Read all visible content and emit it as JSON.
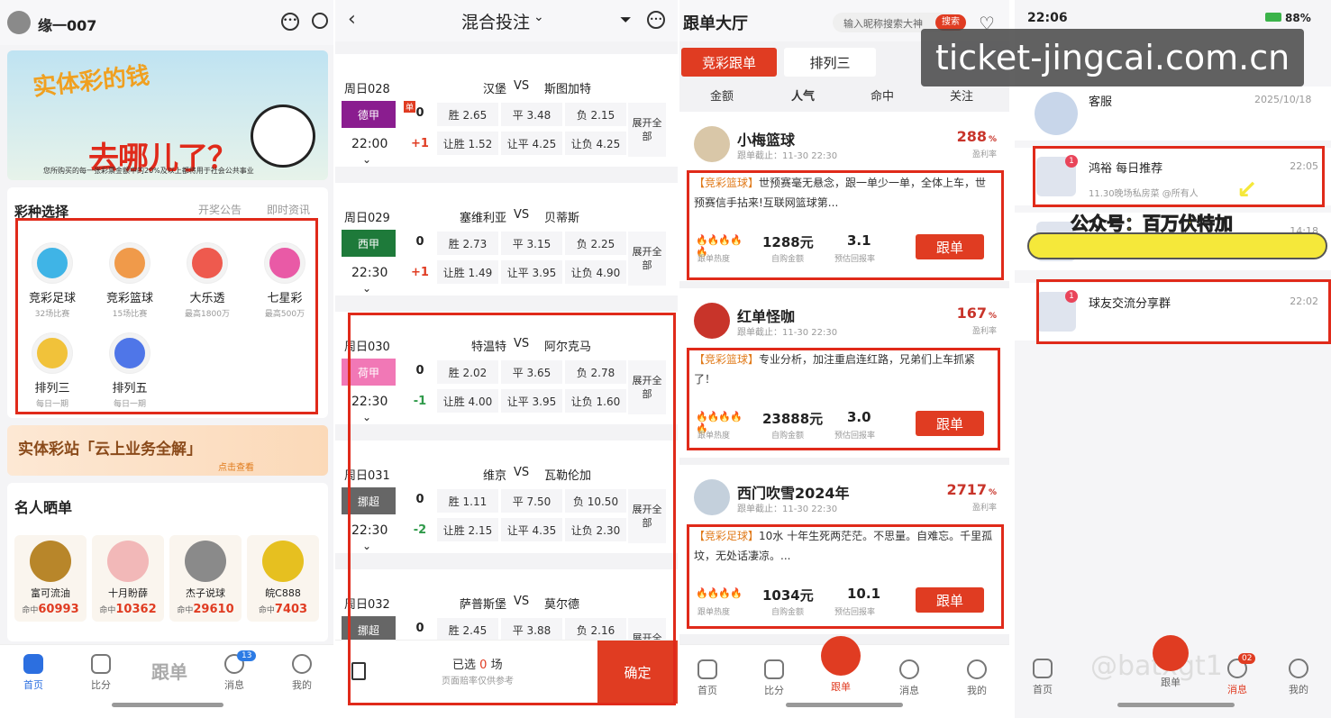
{
  "p1": {
    "username": "缘一007",
    "banner": {
      "title_line1": "实体彩的钱",
      "title_line2": "去哪儿了？",
      "caption": "您所购买的每一张彩票金额中的20%及以上都将用于社会公共事业"
    },
    "section_title": "彩种选择",
    "links": [
      "开奖公告",
      "即时资讯"
    ],
    "lotteries": [
      {
        "name": "竞彩足球",
        "sub": "32场比赛",
        "color": "#3fb4e6"
      },
      {
        "name": "竞彩篮球",
        "sub": "15场比赛",
        "color": "#f09a4a"
      },
      {
        "name": "大乐透",
        "sub": "最高1800万",
        "color": "#ee5a4e"
      },
      {
        "name": "七星彩",
        "sub": "最高500万",
        "color": "#e95aa6"
      },
      {
        "name": "排列三",
        "sub": "每日一期",
        "color": "#f1c23a"
      },
      {
        "name": "排列五",
        "sub": "每日一期",
        "color": "#4f76e8"
      }
    ],
    "promo": {
      "title": "实体彩站「云上业务全解」",
      "cta": "点击查看"
    },
    "famous_title": "名人晒单",
    "famous": [
      {
        "name": "富可流油",
        "hit_label": "命中",
        "hit": "60993"
      },
      {
        "name": "十月盼薛",
        "hit_label": "命中",
        "hit": "10362"
      },
      {
        "name": "杰子说球",
        "hit_label": "命中",
        "hit": "29610"
      },
      {
        "name": "皖C888",
        "hit_label": "命中",
        "hit": "7403"
      }
    ],
    "tabs": [
      "首页",
      "比分",
      "跟单",
      "消息",
      "我的"
    ],
    "msg_badge": "13"
  },
  "p2": {
    "title": "混合投注",
    "matches": [
      {
        "no": "周日028",
        "league": "德甲",
        "league_color": "#8a1d8f",
        "time": "22:00",
        "home": "汉堡",
        "vs": "VS",
        "away": "斯图加特",
        "line0": "0",
        "hcap": "+1",
        "hcap_color": "#e03c22",
        "odds": [
          "胜 2.65",
          "平 3.48",
          "负 2.15"
        ],
        "hodds": [
          "让胜 1.52",
          "让平 4.25",
          "让负 4.25"
        ],
        "single": "单"
      },
      {
        "no": "周日029",
        "league": "西甲",
        "league_color": "#1e7a3a",
        "time": "22:30",
        "home": "塞维利亚",
        "vs": "VS",
        "away": "贝蒂斯",
        "line0": "0",
        "hcap": "+1",
        "hcap_color": "#e03c22",
        "odds": [
          "胜 2.73",
          "平 3.15",
          "负 2.25"
        ],
        "hodds": [
          "让胜 1.49",
          "让平 3.95",
          "让负 4.90"
        ]
      },
      {
        "no": "周日030",
        "league": "荷甲",
        "league_color": "#f178b6",
        "time": "22:30",
        "home": "特温特",
        "vs": "VS",
        "away": "阿尔克马",
        "line0": "0",
        "hcap": "-1",
        "hcap_color": "#2f9a4a",
        "odds": [
          "胜 2.02",
          "平 3.65",
          "负 2.78"
        ],
        "hodds": [
          "让胜 4.00",
          "让平 3.95",
          "让负 1.60"
        ]
      },
      {
        "no": "周日031",
        "league": "挪超",
        "league_color": "#666",
        "time": "22:30",
        "home": "维京",
        "vs": "VS",
        "away": "瓦勒伦加",
        "line0": "0",
        "hcap": "-2",
        "hcap_color": "#2f9a4a",
        "odds": [
          "胜 1.11",
          "平 7.50",
          "负 10.50"
        ],
        "hodds": [
          "让胜 2.15",
          "让平 4.35",
          "让负 2.30"
        ]
      },
      {
        "no": "周日032",
        "league": "挪超",
        "league_color": "#666",
        "time": "",
        "home": "萨普斯堡",
        "vs": "VS",
        "away": "莫尔德",
        "line0": "0",
        "hcap": "",
        "hcap_color": "#2f9a4a",
        "odds": [
          "胜 2.45",
          "平 3.88",
          "负 2.16"
        ],
        "hodds": [
          "",
          "",
          ""
        ]
      }
    ],
    "expand_label": "展开全部",
    "selected_prefix": "已选",
    "selected_count": "0",
    "selected_unit": "场",
    "note": "页面赔率仅供参考",
    "confirm": "确定"
  },
  "p3": {
    "title": "跟单大厅",
    "search_placeholder": "输入昵称搜索大神",
    "search_btn": "搜索",
    "top_tabs": [
      "竞彩跟单",
      "排列三"
    ],
    "sort_tabs": [
      "金额",
      "人气",
      "命中",
      "关注"
    ],
    "cards": [
      {
        "name": "小梅篮球",
        "deadline": "跟单截止：11-30 22:30",
        "rate": "288",
        "pct": "%",
        "rate_label": "盈利率",
        "tag": "【竞彩篮球】",
        "text": "世预赛毫无悬念，跟一单少一单，全体上车，世预赛信手拈来!互联网篮球第...",
        "heat": "🔥🔥🔥🔥🔥",
        "heat_label": "跟单热度",
        "amount": "1288元",
        "amount_label": "自购金额",
        "ret": "3.1",
        "ret_label": "预估回报率",
        "btn": "跟单"
      },
      {
        "name": "红单怪咖",
        "deadline": "跟单截止：11-30 22:30",
        "rate": "167",
        "pct": "%",
        "rate_label": "盈利率",
        "tag": "【竞彩篮球】",
        "text": "专业分析，加注重启连红路，兄弟们上车抓紧了！",
        "heat": "🔥🔥🔥🔥🔥",
        "heat_label": "跟单热度",
        "amount": "23888元",
        "amount_label": "自购金额",
        "ret": "3.0",
        "ret_label": "预估回报率",
        "btn": "跟单"
      },
      {
        "name": "西门吹雪2024年",
        "deadline": "跟单截止：11-30 22:30",
        "rate": "2717",
        "pct": "%",
        "rate_label": "盈利率",
        "tag": "【竞彩足球】",
        "text": "10水 十年生死两茫茫。不思量。自难忘。千里孤坟，无处话凄凉。...",
        "heat": "🔥🔥🔥🔥",
        "heat_label": "跟单热度",
        "amount": "1034元",
        "amount_label": "自购金额",
        "ret": "10.1",
        "ret_label": "预估回报率",
        "btn": "跟单"
      }
    ],
    "tabs": [
      "首页",
      "比分",
      "跟单",
      "消息",
      "我的"
    ]
  },
  "p4": {
    "status_time": "22:06",
    "status_right": "88%",
    "watermark": "ticket-jingcai.com.cn",
    "service": {
      "name": "客服",
      "date": "2025/10/18"
    },
    "chats": [
      {
        "name": "鸿裕 每日推荐",
        "time": "22:05",
        "preview": "11.30晚场私房菜 @所有人",
        "badge": "1"
      },
      {
        "name": "",
        "time": "14:18",
        "preview": "",
        "badge": ""
      },
      {
        "name": "球友交流分享群",
        "time": "22:02",
        "preview": "",
        "badge": "1"
      }
    ],
    "overlay": "公众号：百万伏特加",
    "bottom_watermark": "@batxgt1",
    "tabs": [
      "首页",
      "消息",
      "跟单",
      "消息",
      "我的"
    ],
    "msg_badge": "02"
  }
}
